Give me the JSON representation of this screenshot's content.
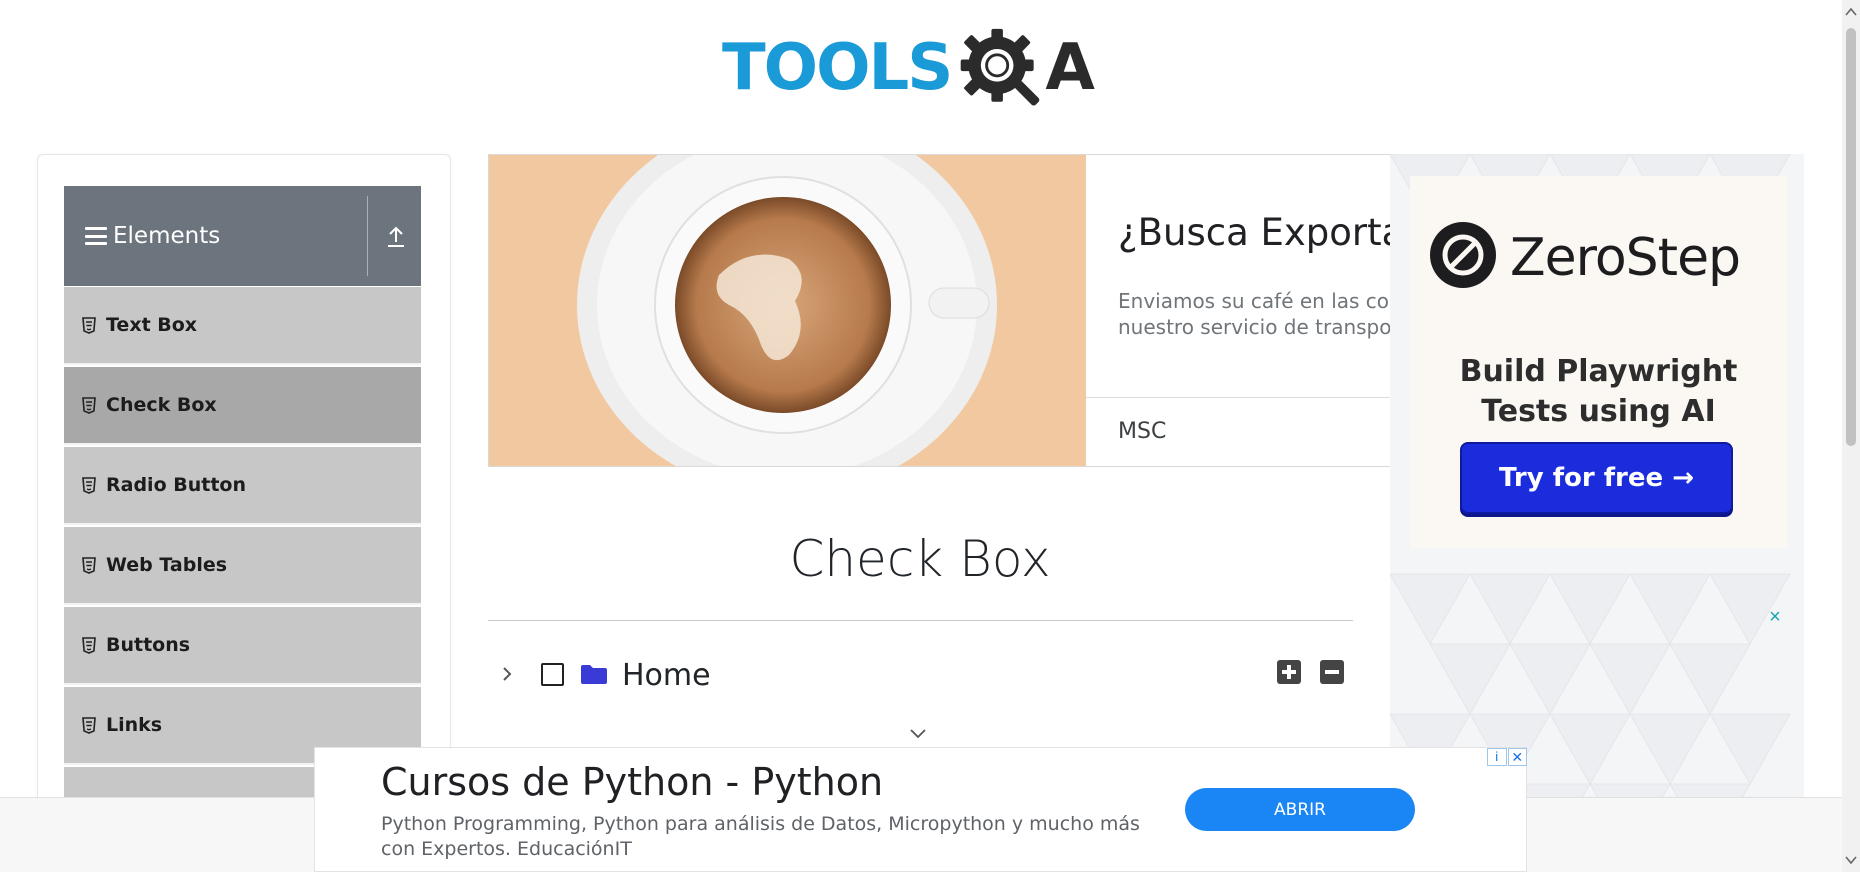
{
  "logo": {
    "text_main": "TOOLS",
    "text_qa": "A"
  },
  "sidebar": {
    "group_title": "Elements",
    "items": [
      {
        "label": "Text Box",
        "active": false
      },
      {
        "label": "Check Box",
        "active": true
      },
      {
        "label": "Radio Button",
        "active": false
      },
      {
        "label": "Web Tables",
        "active": false
      },
      {
        "label": "Buttons",
        "active": false
      },
      {
        "label": "Links",
        "active": false
      }
    ]
  },
  "top_ad": {
    "headline": "¿Busca Exportar",
    "description_line1": "Enviamos su café en las co",
    "description_line2": "nuestro servicio de transpo",
    "source": "MSC"
  },
  "main": {
    "page_title": "Check Box",
    "tree": {
      "root_label": "Home",
      "checked": false,
      "expanded": false
    }
  },
  "right_ad": {
    "brand": "ZeroStep",
    "tagline_line1": "Build Playwright",
    "tagline_line2": "Tests using AI",
    "cta_label": "Try for free →",
    "close_symbol": "×"
  },
  "bottom_ad": {
    "title": "Cursos de Python - Python",
    "description": "Python Programming, Python para análisis de Datos, Micropython y mucho más con Expertos. EducaciónIT",
    "button_label": "ABRIR",
    "info_symbol": "i",
    "close_symbol": "✕"
  },
  "colors": {
    "logo_blue": "#1a9ad6",
    "sidebar_header": "#6c757d",
    "menu_item": "#c7c7c7",
    "menu_item_active": "#a8a8a8",
    "folder": "#3a3ad6",
    "zerostep_cta": "#1b2cdd",
    "ad_button": "#1a86f5"
  }
}
